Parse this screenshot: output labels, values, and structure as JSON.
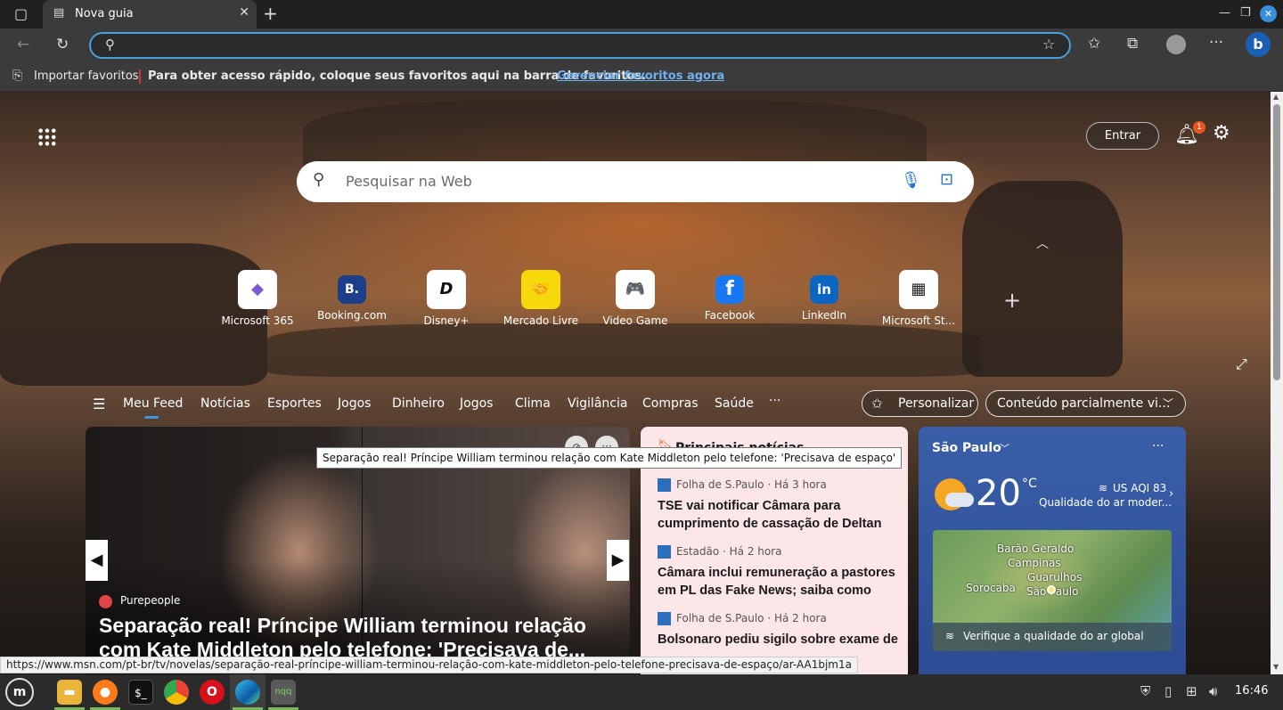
{
  "browser": {
    "tab_title": "Nova guia",
    "address_value": "",
    "icons": [
      "sidebar-icon",
      "tab-page-icon",
      "close-icon",
      "new-tab-icon",
      "back-icon",
      "refresh-icon",
      "search-icon",
      "add-favorite-icon",
      "favorites-icon",
      "collections-icon",
      "profile-icon",
      "more-icon",
      "bing-icon"
    ]
  },
  "favbar": {
    "import_label": "Importar favoritos",
    "message": "Para obter acesso rápido, coloque seus favoritos aqui na barra de favoritos.",
    "manage_link": "Gerenciar favoritos agora"
  },
  "newtab": {
    "signin_label": "Entrar",
    "notification_count": "1",
    "search_placeholder": "Pesquisar na Web",
    "tiles": [
      {
        "label": "Microsoft 365",
        "glyph": "◆",
        "color": "#7b5cd6"
      },
      {
        "label": "Booking.com",
        "glyph": "B.",
        "color": "#1d3e8a"
      },
      {
        "label": "Disney+",
        "glyph": "D",
        "color": "#111111"
      },
      {
        "label": "Mercado Livre",
        "glyph": "🤝",
        "color": "#f5d90a"
      },
      {
        "label": "Video Game",
        "glyph": "🎮",
        "color": "#3b3bd6"
      },
      {
        "label": "Facebook",
        "glyph": "f",
        "color": "#1877f2"
      },
      {
        "label": "LinkedIn",
        "glyph": "in",
        "color": "#0a66c2"
      },
      {
        "label": "Microsoft St...",
        "glyph": "▦",
        "color": "#222222"
      }
    ],
    "feed_nav": [
      "Meu Feed",
      "Notícias",
      "Esportes",
      "Jogos",
      "Dinheiro",
      "Jogos",
      "Clima",
      "Vigilância",
      "Compras",
      "Saúde",
      "···"
    ],
    "personalize_label": "Personalizar",
    "content_label": "Conteúdo parcialmente vi..."
  },
  "hero": {
    "source": "Purepeople",
    "headline": "Separação real! Príncipe William terminou relação com Kate Middleton pelo telefone: 'Precisava de..."
  },
  "news": {
    "header": "Principais notícias",
    "items": [
      {
        "source": "Folha de S.Paulo · Há 3 hora",
        "title": "TSE vai notificar Câmara para cumprimento de cassação de Deltan"
      },
      {
        "source": "Estadão · Há 2 hora",
        "title": "Câmara inclui remuneração a pastores em PL das Fake News; saiba como"
      },
      {
        "source": "Folha de S.Paulo · Há 2 hora",
        "title": "Bolsonaro pediu sigilo sobre exame de Covid um dia após se aglomerar..."
      }
    ]
  },
  "weather": {
    "city": "São Paulo",
    "temp": "20",
    "unit": "°C",
    "aqi": "US AQI 83",
    "aqi_desc": "Qualidade do ar moder...",
    "map_cities": [
      "Barão Geraldo",
      "Campinas",
      "Guarulhos",
      "Sorocaba",
      "São Paulo"
    ],
    "map_link": "Verifique a qualidade do ar global"
  },
  "tooltip": "Separação real! Príncipe William terminou relação com Kate Middleton pelo telefone: 'Precisava de espaço'",
  "status_url": "https://www.msn.com/pt-br/tv/novelas/separação-real-príncipe-william-terminou-relação-com-kate-middleton-pelo-telefone-precisava-de-espaço/ar-AA1bjm1a",
  "taskbar": {
    "apps": [
      "menu-icon",
      "files-icon",
      "firefox-icon",
      "terminal-icon",
      "chrome-icon",
      "opera-icon",
      "edge-icon",
      "nqq-icon"
    ],
    "nqq_label": "nqq",
    "clock": "16:46"
  }
}
